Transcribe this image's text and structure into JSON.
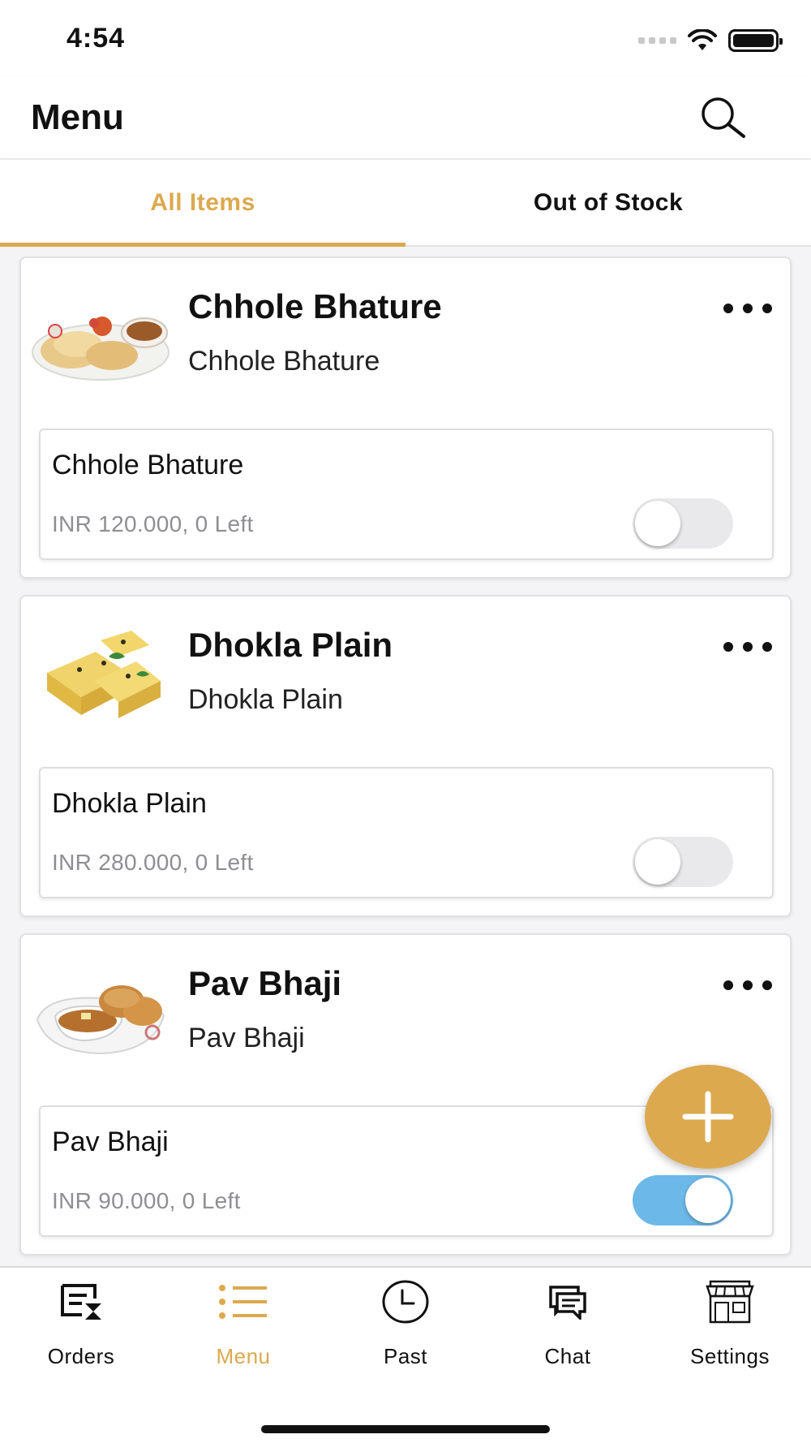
{
  "status_bar": {
    "time": "4:54"
  },
  "header": {
    "title": "Menu",
    "search_icon": "search-icon"
  },
  "tabs": [
    {
      "label": "All Items",
      "active": true
    },
    {
      "label": "Out of Stock",
      "active": false
    }
  ],
  "items": [
    {
      "name": "Chhole Bhature",
      "subtitle": "Chhole Bhature",
      "image": "chhole-bhature-image",
      "variant": {
        "name": "Chhole Bhature",
        "price": "INR 120.000, 0 Left",
        "available": false
      }
    },
    {
      "name": "Dhokla Plain",
      "subtitle": "Dhokla Plain",
      "image": "dhokla-image",
      "variant": {
        "name": "Dhokla Plain",
        "price": "INR 280.000, 0 Left",
        "available": false
      }
    },
    {
      "name": "Pav Bhaji",
      "subtitle": "Pav Bhaji",
      "image": "pav-bhaji-image",
      "variant": {
        "name": "Pav Bhaji",
        "price": "INR 90.000, 0 Left",
        "available": true
      }
    }
  ],
  "fab": {
    "icon": "plus-icon"
  },
  "bottom_nav": [
    {
      "label": "Orders",
      "icon": "orders-icon",
      "active": false
    },
    {
      "label": "Menu",
      "icon": "menu-list-icon",
      "active": true
    },
    {
      "label": "Past",
      "icon": "clock-icon",
      "active": false
    },
    {
      "label": "Chat",
      "icon": "chat-icon",
      "active": false
    },
    {
      "label": "Settings",
      "icon": "store-icon",
      "active": false
    }
  ],
  "colors": {
    "accent": "#dca94f",
    "toggle_on": "#6cb8e8",
    "toggle_off": "#e9e9eb",
    "muted_text": "#8e8e93"
  }
}
